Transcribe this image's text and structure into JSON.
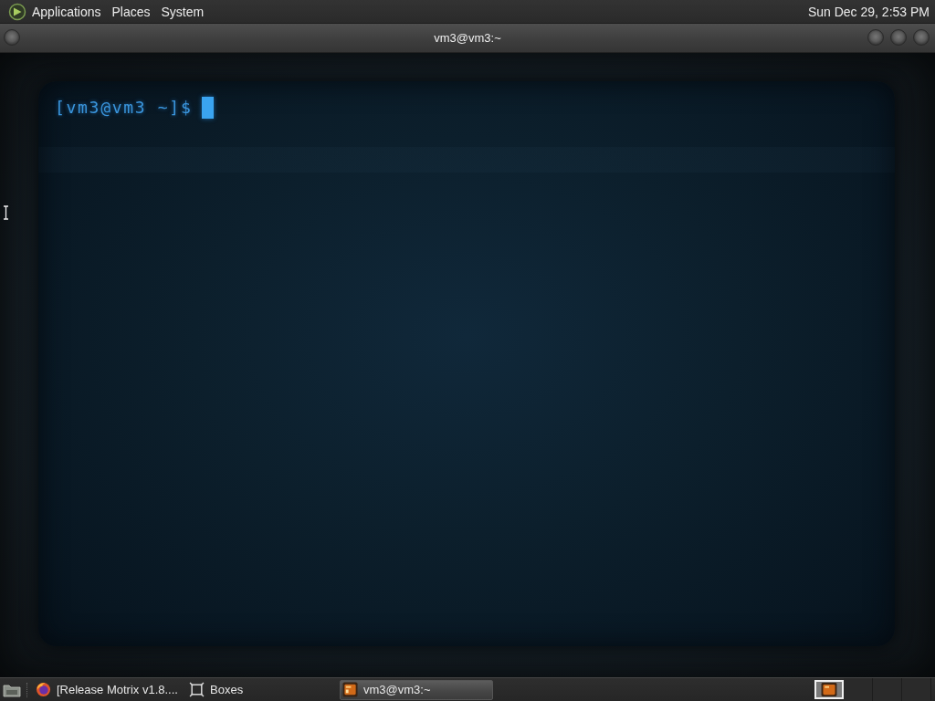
{
  "top_panel": {
    "menus": [
      {
        "label": "Applications"
      },
      {
        "label": "Places"
      },
      {
        "label": "System"
      }
    ],
    "clock": "Sun Dec 29, 2:53 PM"
  },
  "window": {
    "title": "vm3@vm3:~"
  },
  "terminal": {
    "prompt": "[vm3@vm3 ~]$"
  },
  "taskbar": {
    "tasks": [
      {
        "kind": "browser",
        "label": "[Release Motrix v1.8....",
        "selected": false
      },
      {
        "kind": "boxes",
        "label": "Boxes",
        "selected": false
      },
      {
        "kind": "terminal",
        "label": "vm3@vm3:~",
        "selected": true
      }
    ],
    "workspaces": [
      {
        "selected": true
      },
      {
        "selected": false
      },
      {
        "selected": false
      },
      {
        "selected": false
      }
    ]
  }
}
